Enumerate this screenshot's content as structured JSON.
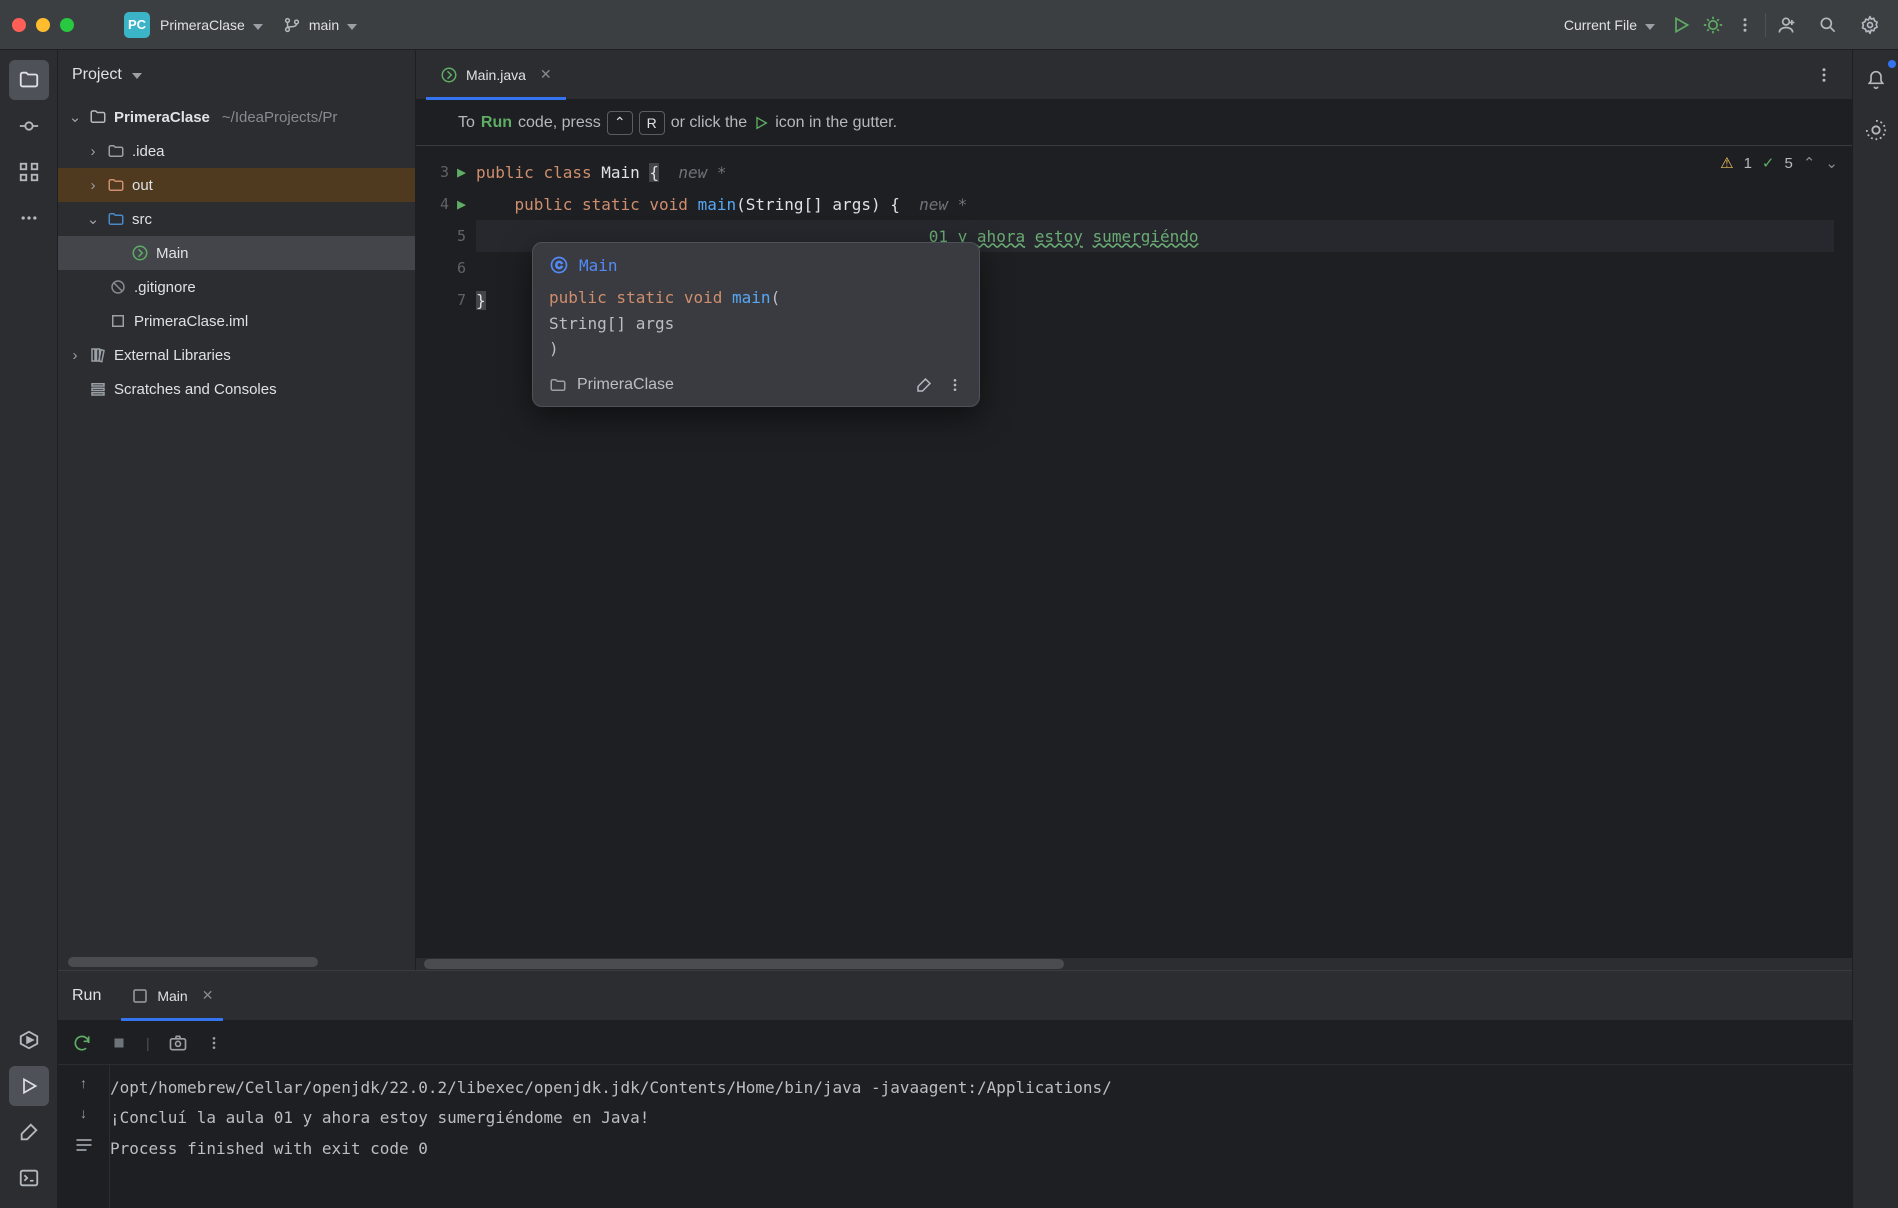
{
  "titlebar": {
    "projectBadge": "PC",
    "projectName": "PrimeraClase",
    "branch": "main",
    "runConfig": "Current File"
  },
  "projectPanel": {
    "title": "Project",
    "rootName": "PrimeraClase",
    "rootPath": "~/IdeaProjects/Pr",
    "items": {
      "idea": ".idea",
      "out": "out",
      "src": "src",
      "main": "Main",
      "gitignore": ".gitignore",
      "iml": "PrimeraClase.iml",
      "external": "External Libraries",
      "scratches": "Scratches and Consoles"
    }
  },
  "editor": {
    "tabName": "Main.java",
    "banner": {
      "prefix": "To ",
      "run": "Run",
      "mid1": " code, press ",
      "key1": "⌃",
      "key2": "R",
      "mid2": " or click the ",
      "suffix": " icon in the gutter."
    },
    "gutter": [
      "3",
      "4",
      "5",
      "6",
      "7"
    ],
    "inspections": {
      "warnings": "1",
      "passes": "5"
    },
    "code": {
      "line3_kw1": "public ",
      "line3_kw2": "class ",
      "line3_name": "Main ",
      "line3_brace": "{",
      "line3_hint": "  new *",
      "line4_indent": "    ",
      "line4_kw": "public static void ",
      "line4_fn": "main",
      "line4_params": "(String[] args) {",
      "line4_hint": "  new *",
      "line5_indent": "                                               ",
      "line5_text": "01 y ",
      "line5_a": "ahora",
      "line5_sp1": " ",
      "line5_b": "estoy",
      "line5_sp2": " ",
      "line5_c": "sumergiéndo",
      "line6_indent": "    ",
      "line7_brace": "}"
    },
    "popup": {
      "className": "Main",
      "sig1": "public static void ",
      "sigFn": "main",
      "sig2": "(",
      "sigArgs": "    String[] args",
      "sig3": ")",
      "module": "PrimeraClase"
    }
  },
  "runPanel": {
    "title": "Run",
    "tabName": "Main",
    "console": {
      "line1": "/opt/homebrew/Cellar/openjdk/22.0.2/libexec/openjdk.jdk/Contents/Home/bin/java -javaagent:/Applications/",
      "line2": "¡Concluí la aula 01 y ahora estoy sumergiéndome en Java!",
      "line3": "Process finished with exit code 0"
    }
  }
}
